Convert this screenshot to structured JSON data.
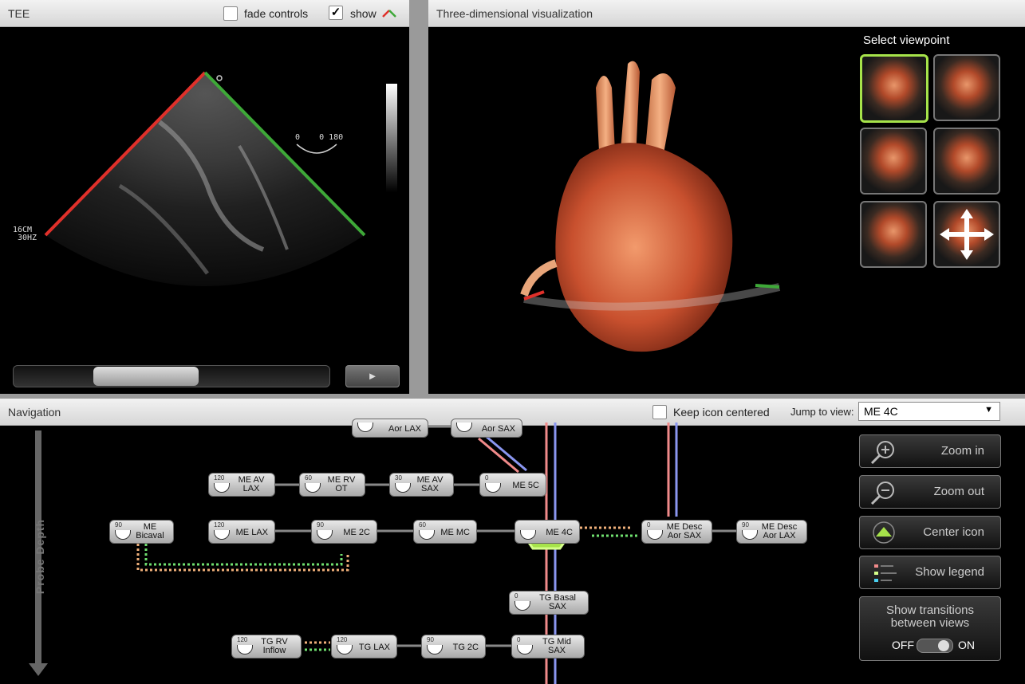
{
  "tee": {
    "title": "TEE",
    "fade_controls_label": "fade controls",
    "fade_controls_checked": false,
    "show_label": "show",
    "show_checked": true,
    "check_mark": "✓",
    "depth_readout": "16CM",
    "freq_readout": "30HZ",
    "angle_readout": "0    0 180",
    "play_label": "►"
  },
  "viz": {
    "title": "Three-dimensional visualization",
    "viewpoint_title": "Select viewpoint"
  },
  "nav": {
    "title": "Navigation",
    "keep_centered_label": "Keep icon centered",
    "keep_centered_checked": false,
    "jump_label": "Jump to view:",
    "jump_value": "ME 4C",
    "probe_depth_label": "Probe Depth",
    "buttons": {
      "zoom_in": "Zoom in",
      "zoom_out": "Zoom out",
      "center_icon": "Center icon",
      "show_legend": "Show legend",
      "show_transitions": "Show transitions between views",
      "toggle_off": "OFF",
      "toggle_on": "ON"
    },
    "nodes": {
      "aor_lax": {
        "angle": "",
        "name": "Aor LAX"
      },
      "aor_sax": {
        "angle": "",
        "name": "Aor SAX"
      },
      "me_av_lax": {
        "angle": "120",
        "name": "ME AV LAX"
      },
      "me_rv_ot": {
        "angle": "60",
        "name": "ME RV OT"
      },
      "me_av_sax": {
        "angle": "30",
        "name": "ME AV SAX"
      },
      "me_5c": {
        "angle": "0",
        "name": "ME 5C"
      },
      "me_bicaval": {
        "angle": "90",
        "name": "ME Bicaval"
      },
      "me_lax": {
        "angle": "120",
        "name": "ME LAX"
      },
      "me_2c": {
        "angle": "90",
        "name": "ME 2C"
      },
      "me_mc": {
        "angle": "60",
        "name": "ME MC"
      },
      "me_4c": {
        "angle": "",
        "name": "ME 4C"
      },
      "me_desc_aor_sax": {
        "angle": "0",
        "name": "ME Desc Aor SAX"
      },
      "me_desc_aor_lax": {
        "angle": "90",
        "name": "ME Desc Aor LAX"
      },
      "tg_basal_sax": {
        "angle": "0",
        "name": "TG Basal SAX"
      },
      "tg_rv_inflow": {
        "angle": "120",
        "name": "TG RV Inflow"
      },
      "tg_lax": {
        "angle": "120",
        "name": "TG LAX"
      },
      "tg_2c": {
        "angle": "90",
        "name": "TG 2C"
      },
      "tg_mid_sax": {
        "angle": "0",
        "name": "TG Mid SAX"
      }
    }
  },
  "colors": {
    "sector_red": "#e0302a",
    "sector_green": "#3ea838",
    "selected_green": "#a6e34a",
    "arrow_red": "#f08a8a",
    "arrow_blue": "#8a96f0",
    "arrow_orange": "#f0b07a"
  }
}
